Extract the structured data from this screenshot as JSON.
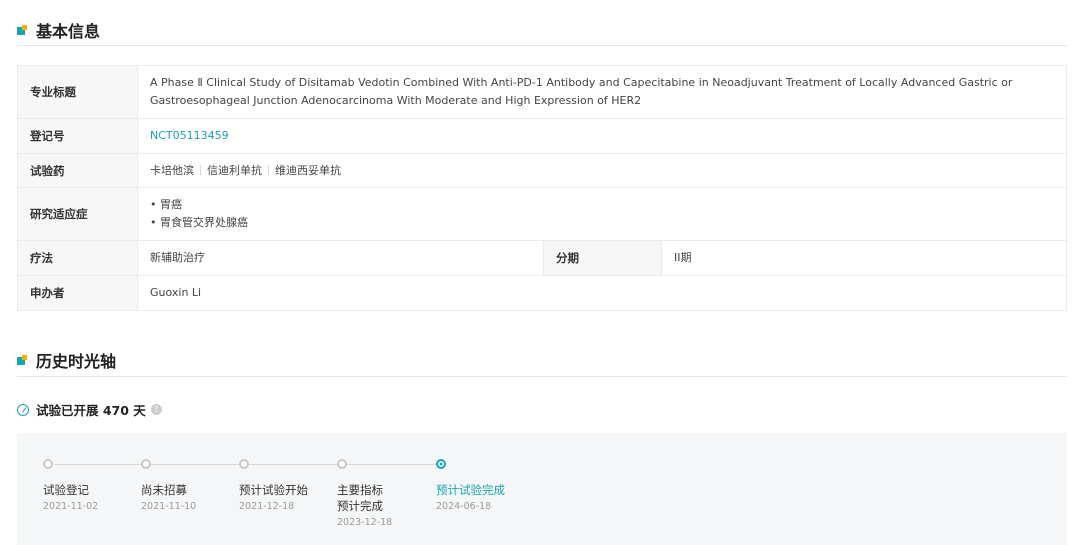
{
  "basic_info": {
    "section_title": "基本信息",
    "rows": {
      "title_label": "专业标题",
      "title_value": "A Phase Ⅱ Clinical Study of Disitamab Vedotin Combined With Anti-PD-1 Antibody and Capecitabine in Neoadjuvant Treatment of Locally Advanced Gastric or Gastroesophageal Junction Adenocarcinoma With Moderate and High Expression of HER2",
      "reg_label": "登记号",
      "reg_value": "NCT05113459",
      "drug_label": "试验药",
      "drugs": [
        "卡培他滨",
        "信迪利单抗",
        "维迪西妥单抗"
      ],
      "indication_label": "研究适应症",
      "indications": [
        "胃癌",
        "胃食管交界处腺癌"
      ],
      "therapy_label": "疗法",
      "therapy_value": "新辅助治疗",
      "phase_label": "分期",
      "phase_value": "II期",
      "sponsor_label": "申办者",
      "sponsor_value": "Guoxin Li"
    }
  },
  "history": {
    "section_title": "历史时光轴",
    "days_text": "试验已开展 470 天",
    "help_glyph": "?",
    "steps": [
      {
        "label_lines": [
          "试验登记"
        ],
        "date": "2021-11-02",
        "active": false
      },
      {
        "label_lines": [
          "尚未招募"
        ],
        "date": "2021-11-10",
        "active": false
      },
      {
        "label_lines": [
          "预计试验开始"
        ],
        "date": "2021-12-18",
        "active": false
      },
      {
        "label_lines": [
          "主要指标",
          "预计完成"
        ],
        "date": "2023-12-18",
        "active": false
      },
      {
        "label_lines": [
          "预计试验完成"
        ],
        "date": "2024-06-18",
        "active": true
      }
    ]
  },
  "colors": {
    "accent": "#1aa3b3",
    "mark_corner": "#f5b300",
    "row_label_bg": "#f7f7f7",
    "timeline_bg": "#f5f6f7"
  }
}
